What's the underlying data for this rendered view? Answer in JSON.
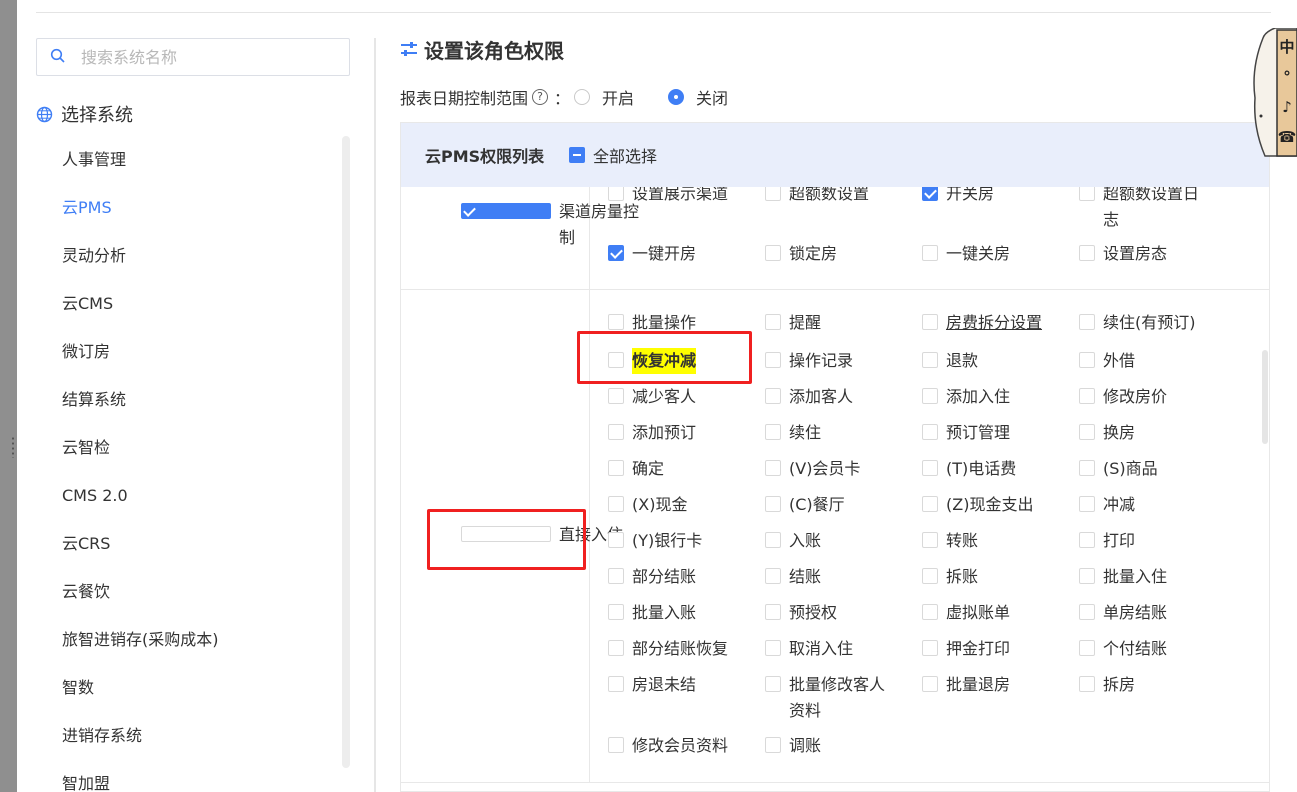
{
  "search": {
    "placeholder": "搜索系统名称"
  },
  "sidebar": {
    "title": "选择系统",
    "items": [
      {
        "label": "人事管理",
        "active": false
      },
      {
        "label": "云PMS",
        "active": true
      },
      {
        "label": "灵动分析",
        "active": false
      },
      {
        "label": "云CMS",
        "active": false
      },
      {
        "label": "微订房",
        "active": false
      },
      {
        "label": "结算系统",
        "active": false
      },
      {
        "label": "云智检",
        "active": false
      },
      {
        "label": "CMS 2.0",
        "active": false
      },
      {
        "label": "云CRS",
        "active": false
      },
      {
        "label": "云餐饮",
        "active": false
      },
      {
        "label": "旅智进销存(采购成本)",
        "active": false
      },
      {
        "label": "智数",
        "active": false
      },
      {
        "label": "进销存系统",
        "active": false
      },
      {
        "label": "智加盟",
        "active": false
      }
    ]
  },
  "main": {
    "title": "设置该角色权限",
    "date_control": {
      "label": "报表日期控制范围",
      "colon": "：",
      "help": "?",
      "options": [
        "开启",
        "关闭"
      ],
      "selected": "关闭"
    },
    "table": {
      "header": "云PMS权限列表",
      "select_all": "全部选择",
      "groups": [
        {
          "label": "渠道房量控制",
          "checked": true,
          "perms": [
            {
              "label": "设置展示渠道",
              "checked": false
            },
            {
              "label": "超额数设置",
              "checked": false
            },
            {
              "label": "开关房",
              "checked": true
            },
            {
              "label": "超额数设置日志",
              "checked": false
            },
            {
              "label": "一键开房",
              "checked": true
            },
            {
              "label": "锁定房",
              "checked": false
            },
            {
              "label": "一键关房",
              "checked": false
            },
            {
              "label": "设置房态",
              "checked": false
            }
          ]
        },
        {
          "label": "直接入住",
          "checked": false,
          "perms": [
            {
              "label": "批量操作"
            },
            {
              "label": "提醒"
            },
            {
              "label": "房费拆分设置"
            },
            {
              "label": "续住(有预订)"
            },
            {
              "label": "恢复冲减"
            },
            {
              "label": "操作记录"
            },
            {
              "label": "退款"
            },
            {
              "label": "外借"
            },
            {
              "label": "减少客人"
            },
            {
              "label": "添加客人"
            },
            {
              "label": "添加入住"
            },
            {
              "label": "修改房价"
            },
            {
              "label": "添加预订"
            },
            {
              "label": "续住"
            },
            {
              "label": "预订管理"
            },
            {
              "label": "换房"
            },
            {
              "label": "确定"
            },
            {
              "label": "(V)会员卡"
            },
            {
              "label": "(T)电话费"
            },
            {
              "label": "(S)商品"
            },
            {
              "label": "(X)现金"
            },
            {
              "label": "(C)餐厅"
            },
            {
              "label": "(Z)现金支出"
            },
            {
              "label": "冲减"
            },
            {
              "label": "(Y)银行卡"
            },
            {
              "label": "入账"
            },
            {
              "label": "转账"
            },
            {
              "label": "打印"
            },
            {
              "label": "部分结账"
            },
            {
              "label": "结账"
            },
            {
              "label": "拆账"
            },
            {
              "label": "批量入住"
            },
            {
              "label": "批量入账"
            },
            {
              "label": "预授权"
            },
            {
              "label": "虚拟账单"
            },
            {
              "label": "单房结账"
            },
            {
              "label": "部分结账恢复"
            },
            {
              "label": "取消入住"
            },
            {
              "label": "押金打印"
            },
            {
              "label": "个付结账"
            },
            {
              "label": "房退未结"
            },
            {
              "label": "批量修改客人资料"
            },
            {
              "label": "批量退房"
            },
            {
              "label": "拆房"
            },
            {
              "label": "修改会员资料"
            },
            {
              "label": "调账"
            }
          ]
        }
      ]
    }
  },
  "deco": {
    "chars": [
      "中",
      "°",
      "♪",
      "☎"
    ]
  },
  "colors": {
    "accent": "#3f7ef5",
    "header_bg": "#e9eefb",
    "annotation_red": "#f02020",
    "highlight": "#ffff00"
  }
}
